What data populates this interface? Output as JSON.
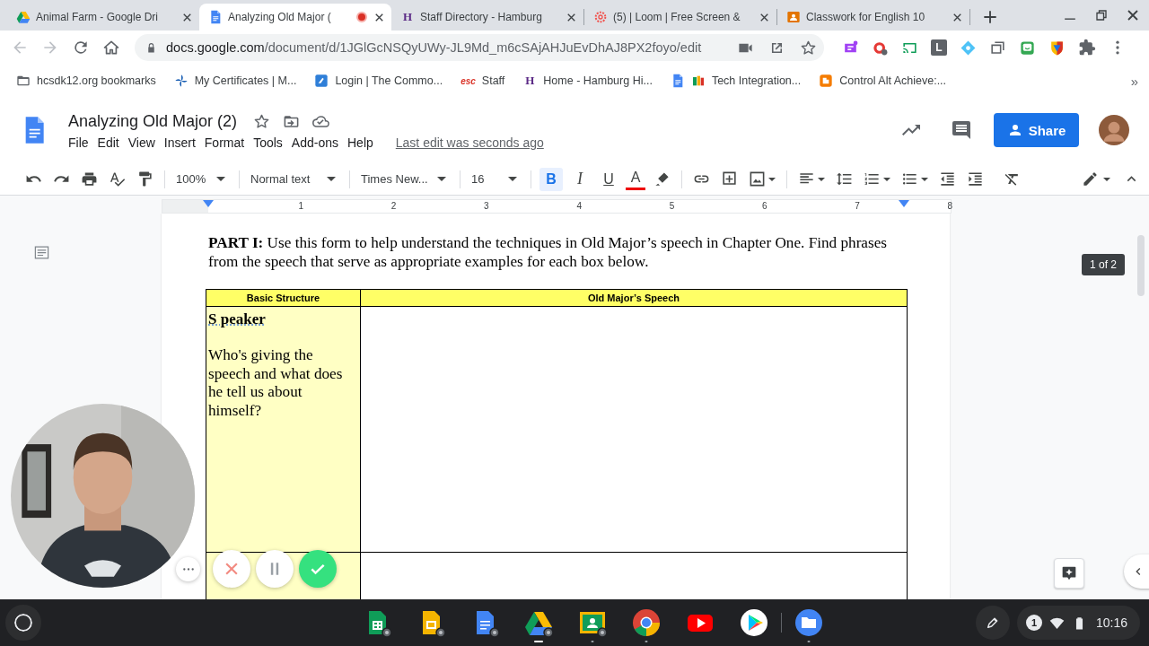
{
  "browser": {
    "tabs": [
      {
        "title": "Animal Farm - Google Dri",
        "kind": "drive",
        "selected": false,
        "recording": false
      },
      {
        "title": "Analyzing Old Major (",
        "kind": "docs",
        "selected": true,
        "recording": true
      },
      {
        "title": "Staff Directory - Hamburg",
        "kind": "letter",
        "letter": "H",
        "selected": false,
        "recording": false
      },
      {
        "title": "(5) | Loom | Free Screen &",
        "kind": "loom",
        "selected": false,
        "recording": false
      },
      {
        "title": "Classwork for English 10",
        "kind": "classroom",
        "selected": false,
        "recording": false
      }
    ],
    "url_host": "docs.google.com",
    "url_path": "/document/d/1JGlGcNSQyUWy-JL9Md_m6cSAjAHJuEvDhAJ8PX2foyo/edit",
    "extensions": [
      {
        "kind": "badge"
      },
      {
        "kind": "vpn"
      },
      {
        "kind": "cast"
      },
      {
        "kind": "letter",
        "letter": "L"
      },
      {
        "kind": "diamond"
      },
      {
        "kind": "tabs"
      },
      {
        "kind": "face"
      },
      {
        "kind": "shield"
      }
    ],
    "bookmarks": [
      {
        "label": "hcsdk12.org bookmarks",
        "kind": "folder"
      },
      {
        "label": "My Certificates | M...",
        "kind": "pinwheel"
      },
      {
        "label": "Login | The Commo...",
        "kind": "commonlit"
      },
      {
        "label": "Staff",
        "kind": "wordmark",
        "letter": "esc"
      },
      {
        "label": "Home - Hamburg Hi...",
        "kind": "letter",
        "letter": "H"
      },
      {
        "label": "Tech Integration...",
        "kind": "docs-pair"
      },
      {
        "label": "Control Alt Achieve:...",
        "kind": "blogger"
      }
    ],
    "bookmarks_overflow": "»"
  },
  "docs": {
    "title": "Analyzing Old Major (2)",
    "menu": [
      "File",
      "Edit",
      "View",
      "Insert",
      "Format",
      "Tools",
      "Add-ons",
      "Help"
    ],
    "last_edit": "Last edit was seconds ago",
    "share": "Share",
    "toolbar": {
      "zoom": "100%",
      "style": "Normal text",
      "font": "Times New...",
      "size": "16",
      "format": [
        {
          "label": "B",
          "kind": "bold",
          "selected": true
        },
        {
          "label": "I",
          "kind": "italic",
          "selected": false
        },
        {
          "label": "U",
          "kind": "underline",
          "selected": false
        },
        {
          "label": "A",
          "kind": "text-color",
          "selected": false
        }
      ]
    },
    "ruler": [
      "1",
      "2",
      "3",
      "4",
      "5",
      "6",
      "7",
      "8"
    ],
    "page_indicator": "1 of 2",
    "body": {
      "intro": "**PART I:** Use this form to help understand the techniques in Old Major’s speech in Chapter One. Find phrases from the speech that serve as appropriate examples for each box below.",
      "table": {
        "columns": [
          "Basic Structure",
          "Old Major’s Speech"
        ],
        "rows": [
          {
            "heading": "S peaker",
            "prompt": "Who's giving the speech and what does he tell us about himself?"
          },
          {}
        ]
      }
    }
  },
  "shelf": {
    "apps": [
      {
        "kind": "sheets",
        "running": false
      },
      {
        "kind": "slides",
        "running": false
      },
      {
        "kind": "docs",
        "running": false
      },
      {
        "kind": "drive",
        "running": true,
        "focused": true
      },
      {
        "kind": "classroom",
        "running": true
      },
      {
        "kind": "chrome",
        "running": true
      },
      {
        "kind": "youtube",
        "running": false
      },
      {
        "kind": "play",
        "running": false
      },
      {
        "kind": "files",
        "running": true
      }
    ],
    "notifications": "1",
    "time": "10:16"
  }
}
